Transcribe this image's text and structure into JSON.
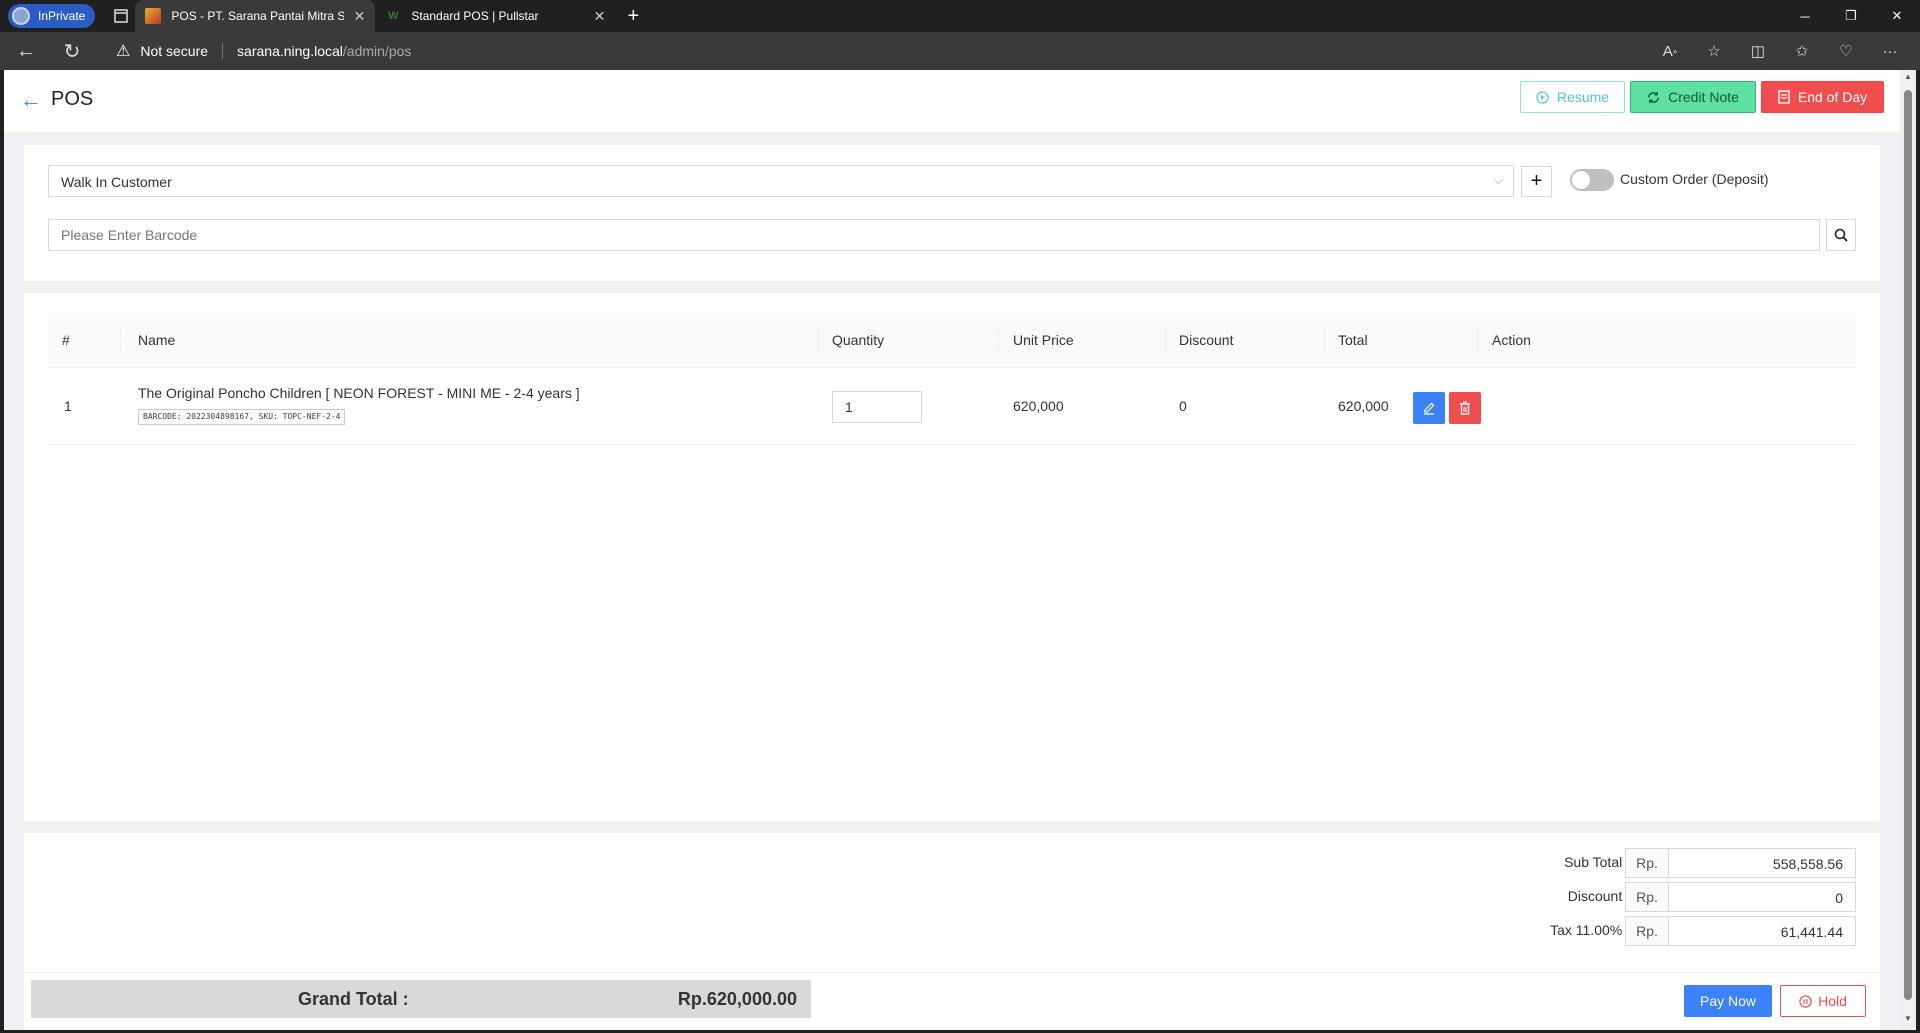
{
  "browser": {
    "inprivate_label": "InPrivate",
    "tabs": [
      {
        "title": "POS - PT. Sarana Pantai Mitra Se",
        "active": true
      },
      {
        "title": "Standard POS | Pullstar",
        "active": false
      }
    ],
    "security_label": "Not secure",
    "url_host": "sarana.ning.local",
    "url_path": "/admin/pos"
  },
  "header": {
    "title": "POS",
    "resume_label": "Resume",
    "credit_note_label": "Credit Note",
    "end_of_day_label": "End of Day"
  },
  "customer": {
    "selected": "Walk In Customer",
    "custom_order_label": "Custom Order (Deposit)",
    "custom_order_enabled": false
  },
  "barcode": {
    "placeholder": "Please Enter Barcode"
  },
  "table": {
    "columns": [
      "#",
      "Name",
      "Quantity",
      "Unit Price",
      "Discount",
      "Total",
      "Action"
    ],
    "rows": [
      {
        "index": "1",
        "name": "The Original Poncho Children [ NEON FOREST - MINI ME - 2-4 years ]",
        "meta": "BARCODE: 2022304898167, SKU: TOPC-NEF-2-4",
        "quantity": "1",
        "unit_price": "620,000",
        "discount": "0",
        "total": "620,000"
      }
    ]
  },
  "summary": {
    "currency": "Rp.",
    "subtotal_label": "Sub Total :",
    "subtotal": "558,558.56",
    "discount_label": "Discount :",
    "discount": "0",
    "tax_label": "Tax 11.00% :",
    "tax": "61,441.44",
    "grand_total_label": "Grand Total :",
    "grand_total": "Rp.620,000.00",
    "pay_label": "Pay Now",
    "hold_label": "Hold"
  },
  "colors": {
    "primary": "#3b82f6",
    "danger": "#f04e4e",
    "success": "#5ee0a0",
    "info": "#53c4d6"
  }
}
